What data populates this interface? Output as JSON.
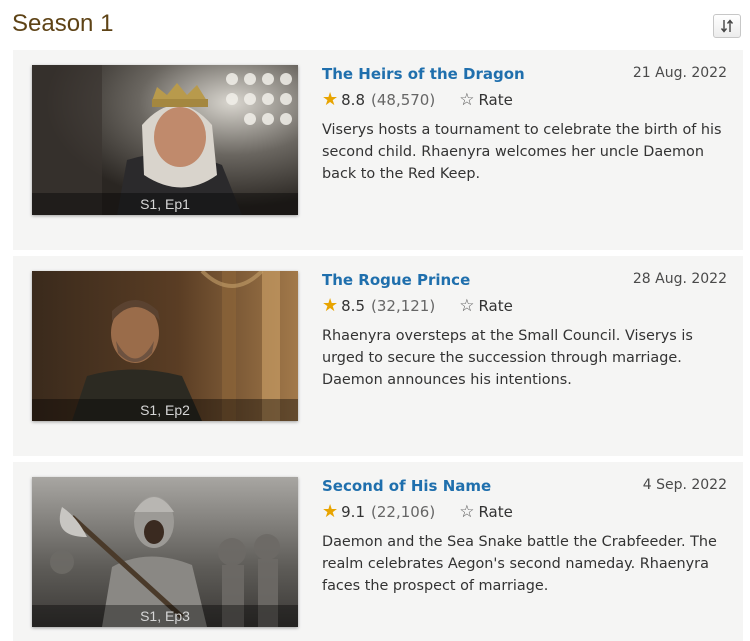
{
  "season": {
    "title": "Season 1"
  },
  "controls": {
    "sort_icon": "sort-arrows-icon"
  },
  "episodes": [
    {
      "label": "S1, Ep1",
      "title": "The Heirs of the Dragon",
      "date": "21 Aug. 2022",
      "rating": "8.8",
      "votes": "(48,570)",
      "rate_label": "Rate",
      "description": "Viserys hosts a tournament to celebrate the birth of his second child. Rhaenyra welcomes her uncle Daemon back to the Red Keep."
    },
    {
      "label": "S1, Ep2",
      "title": "The Rogue Prince",
      "date": "28 Aug. 2022",
      "rating": "8.5",
      "votes": "(32,121)",
      "rate_label": "Rate",
      "description": "Rhaenyra oversteps at the Small Council. Viserys is urged to secure the succession through marriage. Daemon announces his intentions."
    },
    {
      "label": "S1, Ep3",
      "title": "Second of His Name",
      "date": "4 Sep. 2022",
      "rating": "9.1",
      "votes": "(22,106)",
      "rate_label": "Rate",
      "description": "Daemon and the Sea Snake battle the Crabfeeder. The realm celebrates Aegon's second nameday. Rhaenyra faces the prospect of marriage."
    }
  ],
  "colors": {
    "title_link": "#1f6fad",
    "season_title": "#5e4316",
    "star": "#e8a400",
    "card_bg": "#f5f5f4"
  }
}
